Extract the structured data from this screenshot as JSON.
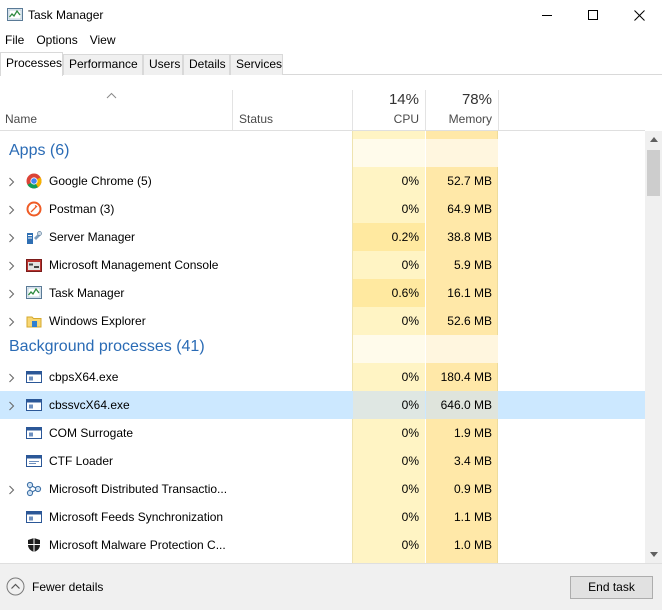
{
  "window": {
    "title": "Task Manager",
    "controls": [
      "minimize",
      "maximize",
      "close"
    ]
  },
  "menu": [
    "File",
    "Options",
    "View"
  ],
  "tabs": [
    {
      "label": "Processes",
      "active": true
    },
    {
      "label": "Performance",
      "active": false
    },
    {
      "label": "Users",
      "active": false
    },
    {
      "label": "Details",
      "active": false
    },
    {
      "label": "Services",
      "active": false
    }
  ],
  "columns": {
    "name": "Name",
    "status": "Status",
    "cpu": {
      "percent": "14%",
      "label": "CPU"
    },
    "memory": {
      "percent": "78%",
      "label": "Memory"
    }
  },
  "groups": [
    {
      "label": "Apps (6)",
      "rows": [
        {
          "name": "Google Chrome (5)",
          "icon": "chrome-icon",
          "expandable": true,
          "cpu": "0%",
          "memory": "52.7 MB"
        },
        {
          "name": "Postman (3)",
          "icon": "postman-icon",
          "expandable": true,
          "cpu": "0%",
          "memory": "64.9 MB"
        },
        {
          "name": "Server Manager",
          "icon": "server-manager-icon",
          "expandable": true,
          "cpu": "0.2%",
          "memory": "38.8 MB"
        },
        {
          "name": "Microsoft Management Console",
          "icon": "mmc-icon",
          "expandable": true,
          "cpu": "0%",
          "memory": "5.9 MB"
        },
        {
          "name": "Task Manager",
          "icon": "task-manager-icon",
          "expandable": true,
          "cpu": "0.6%",
          "memory": "16.1 MB"
        },
        {
          "name": "Windows Explorer",
          "icon": "folder-icon",
          "expandable": true,
          "cpu": "0%",
          "memory": "52.6 MB"
        }
      ]
    },
    {
      "label": "Background processes (41)",
      "rows": [
        {
          "name": "cbpsX64.exe",
          "icon": "app-window-icon",
          "expandable": true,
          "cpu": "0%",
          "memory": "180.4 MB"
        },
        {
          "name": "cbssvcX64.exe",
          "icon": "app-window-icon",
          "expandable": true,
          "cpu": "0%",
          "memory": "646.0 MB",
          "selected": true
        },
        {
          "name": "COM Surrogate",
          "icon": "app-window-icon",
          "expandable": false,
          "cpu": "0%",
          "memory": "1.9 MB"
        },
        {
          "name": "CTF Loader",
          "icon": "ctf-loader-icon",
          "expandable": false,
          "cpu": "0%",
          "memory": "3.4 MB"
        },
        {
          "name": "Microsoft Distributed Transactio...",
          "icon": "distributed-transaction-icon",
          "expandable": true,
          "cpu": "0%",
          "memory": "0.9 MB"
        },
        {
          "name": "Microsoft Feeds Synchronization",
          "icon": "app-window-icon",
          "expandable": false,
          "cpu": "0%",
          "memory": "1.1 MB"
        },
        {
          "name": "Microsoft Malware Protection C...",
          "icon": "shield-icon",
          "expandable": false,
          "cpu": "0%",
          "memory": "1.0 MB"
        }
      ]
    }
  ],
  "footer": {
    "fewer_details": "Fewer details",
    "end_task": "End task"
  },
  "colors": {
    "group_heading": "#2a6bb5",
    "selection": "#cce8ff",
    "cpu_column": "#fff4c4",
    "memory_column": "#ffe8a8"
  }
}
